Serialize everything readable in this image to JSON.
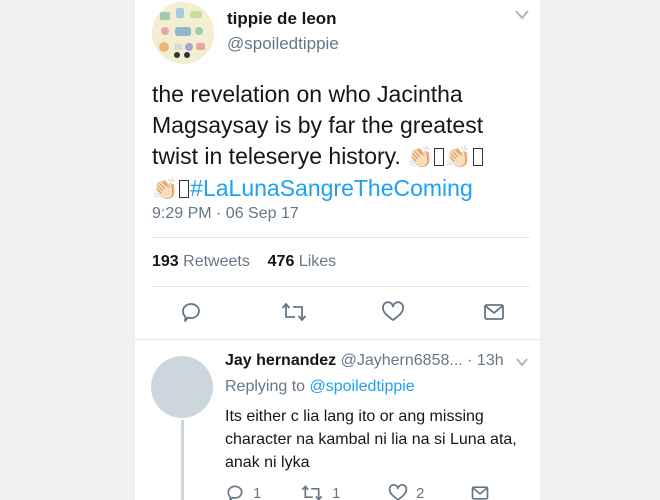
{
  "tweet": {
    "display_name": "tippie de leon",
    "handle": "@spoiledtippie",
    "text_line1": "the revelation on who Jacintha",
    "text_line2": "Magsaysay is by far the greatest",
    "text_line3": "twist in teleserye history.",
    "hashtag": "#LaLunaSangreTheComing",
    "emoji": "👏🏻",
    "timestamp": "9:29 PM · 06 Sep 17",
    "retweets_count": "193",
    "retweets_label": "Retweets",
    "likes_count": "476",
    "likes_label": "Likes",
    "accent_color": "#1da1f2"
  },
  "reply": {
    "display_name": "Jay hernandez",
    "handle": "@Jayhern6858...",
    "time": "· 13h",
    "replying_label": "Replying to",
    "replying_mention": "@spoiledtippie",
    "text_line1": "Its either c lia lang ito or ang missing",
    "text_line2": "character na kambal ni lia na si Luna ata,",
    "text_line3": "anak ni lyka",
    "reply_count": "1",
    "retweet_count": "1",
    "like_count": "2"
  },
  "icons": [
    "chevron-down-icon",
    "reply-icon",
    "retweet-icon",
    "like-icon",
    "share-icon"
  ]
}
